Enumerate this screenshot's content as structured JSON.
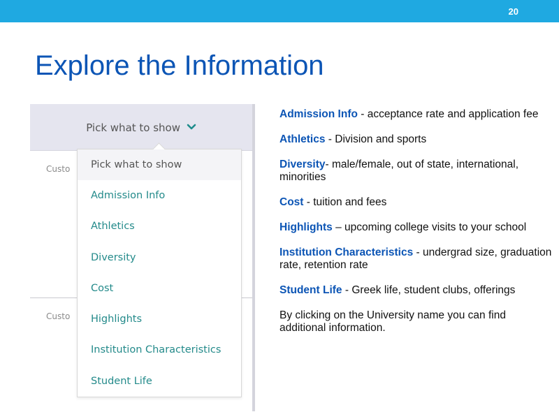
{
  "slide": {
    "number": "20",
    "title": "Explore the Information"
  },
  "colors": {
    "topbar": "#1fa9e1",
    "title": "#0c55b5",
    "teal_link": "#238a8a",
    "panel_header": "#e5e5ef"
  },
  "panel": {
    "picker_label": "Pick what to show",
    "picker_icon": "chevron-down-icon",
    "cust_label_1": "Custo",
    "cust_label_2": "Custo",
    "dropdown": {
      "items": [
        "Pick what to show",
        "Admission Info",
        "Athletics",
        "Diversity",
        "Cost",
        "Highlights",
        "Institution Characteristics",
        "Student Life"
      ]
    }
  },
  "info": [
    {
      "term": "Admission Info",
      "sep": " - ",
      "text": "acceptance rate and application fee"
    },
    {
      "term": "Athletics",
      "sep": " - ",
      "text": "Division and sports"
    },
    {
      "term": "Diversity",
      "sep": "- ",
      "text": "male/female, out of state, international, minorities"
    },
    {
      "term": "Cost",
      "sep": " - ",
      "text": "tuition and fees"
    },
    {
      "term": "Highlights",
      "sep": " – ",
      "text": "upcoming college visits to your school"
    },
    {
      "term": "Institution Characteristics",
      "sep": " - ",
      "text": "undergrad size, graduation rate, retention rate"
    },
    {
      "term": "Student Life",
      "sep": " - ",
      "text": "Greek life, student clubs, offerings"
    }
  ],
  "closing": "By clicking on the University name you can find additional information."
}
